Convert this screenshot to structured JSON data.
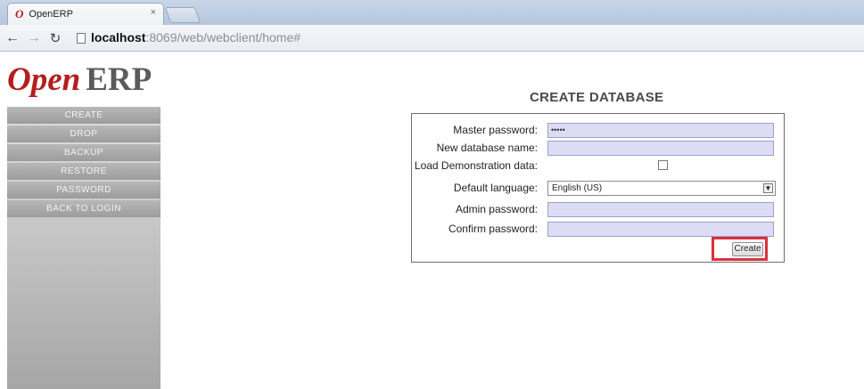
{
  "browser": {
    "tab_title": "OpenERP",
    "tab_icon": "O",
    "tab_close": "×",
    "url_host": "localhost",
    "url_rest": ":8069/web/webclient/home#"
  },
  "logo": {
    "open": "Open",
    "erp": "ERP"
  },
  "sidebar": {
    "items": [
      {
        "label": "CREATE"
      },
      {
        "label": "DROP"
      },
      {
        "label": "BACKUP"
      },
      {
        "label": "RESTORE"
      },
      {
        "label": "PASSWORD"
      },
      {
        "label": "BACK TO LOGIN"
      }
    ]
  },
  "form": {
    "title": "CREATE DATABASE",
    "master_password": {
      "label": "Master password:",
      "value": "•••••"
    },
    "db_name": {
      "label": "New database name:",
      "value": ""
    },
    "demo_data": {
      "label": "Load Demonstration data:",
      "checked": false
    },
    "language": {
      "label": "Default language:",
      "value": "English (US)"
    },
    "admin_password": {
      "label": "Admin password:",
      "value": ""
    },
    "confirm_password": {
      "label": "Confirm password:",
      "value": ""
    },
    "create_label": "Create"
  },
  "colors": {
    "brand_red": "#b41e1e",
    "field_bg": "#dcdcf5",
    "highlight": "#d9323c"
  }
}
